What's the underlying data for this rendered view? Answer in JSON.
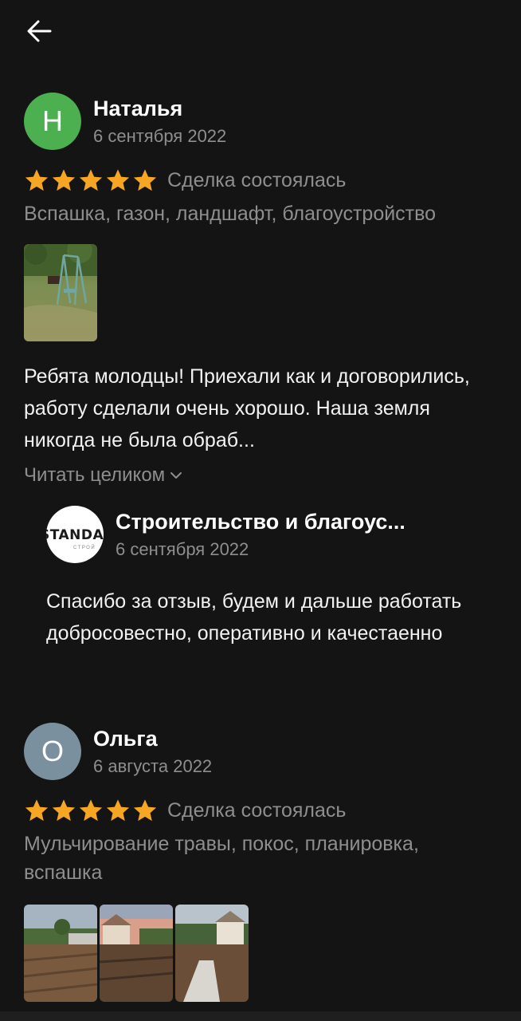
{
  "colors": {
    "background": "#141414",
    "star": "#f6a623",
    "muted_text": "#8e8e8e",
    "avatar_natalia": "#4caf50",
    "avatar_olga": "#7b909e"
  },
  "header": {
    "back_icon": "arrow-left-icon"
  },
  "reviews": [
    {
      "avatar_letter": "Н",
      "author": "Наталья",
      "date": "6 сентября 2022",
      "rating": 5,
      "deal_status": "Сделка состоялась",
      "services": "Вспашка, газон, ландшафт, благоустройство",
      "photos": [
        "garden-swing-photo"
      ],
      "text": "Ребята молодцы! Приехали как и договорились, работу сделали очень хорошо. Наша земля никогда не была обраб...",
      "read_more": "Читать целиком",
      "reply": {
        "logo_text": "STANDA",
        "logo_subtext": "СТРОЙ",
        "company": "Строительство и благоус...",
        "date": "6 сентября 2022",
        "text": "Спасибо за отзыв, будем и дальше работать добросовестно, оперативно и качестаенно"
      }
    },
    {
      "avatar_letter": "О",
      "author": "Ольга",
      "date": "6 августа 2022",
      "rating": 5,
      "deal_status": "Сделка состоялась",
      "services": "Мульчирование травы, покос, планировка, вспашка",
      "photos": [
        "plowed-field-photo-1",
        "plowed-field-photo-2",
        "plowed-field-photo-3"
      ]
    }
  ]
}
